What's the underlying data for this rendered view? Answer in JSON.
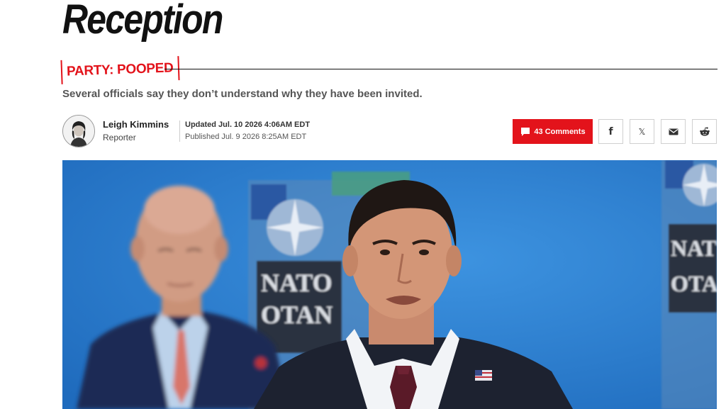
{
  "article": {
    "headline": "Reception",
    "rubric": "PARTY: POOPED",
    "dek": "Several officials say they don’t understand why they have been invited."
  },
  "byline": {
    "author_name": "Leigh Kimmins",
    "author_role": "Reporter",
    "updated": "Updated Jul. 10 2026 4:06AM EDT",
    "published": "Published Jul. 9 2026 8:25AM EDT"
  },
  "actions": {
    "comments_label": "43 Comments",
    "share_icons": [
      "facebook-icon",
      "x-icon",
      "email-icon",
      "reddit-icon"
    ],
    "facebook_glyph": "f",
    "x_glyph": "𝕏"
  },
  "hero": {
    "background_text_1": "NATO",
    "background_text_2": "OTAN",
    "background_text_3": "NAT",
    "background_text_4": "OTA"
  },
  "colors": {
    "accent": "#e3131b",
    "hero_background": "#2d7fd0"
  }
}
